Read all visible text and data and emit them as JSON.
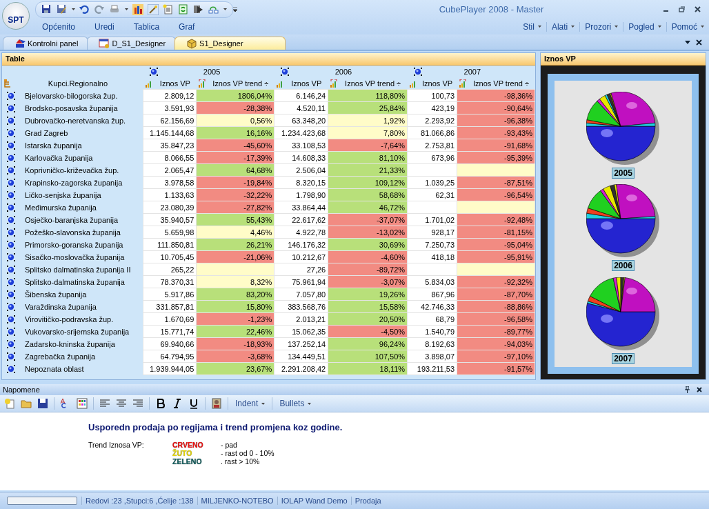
{
  "app_button": "SPT",
  "window": {
    "title": "CubePlayer 2008 - Master"
  },
  "menu": {
    "left": [
      "Općenito",
      "Uredi",
      "Tablica",
      "Graf"
    ],
    "right": [
      "Stil",
      "Alati",
      "Prozori",
      "Pogled",
      "Pomoć"
    ]
  },
  "doc_tabs": [
    {
      "label": "Kontrolni panel",
      "selected": false
    },
    {
      "label": "D_S1_Designer",
      "selected": false
    },
    {
      "label": "S1_Designer",
      "selected": true
    }
  ],
  "table_panel": {
    "title": "Table",
    "row_header": "Kupci.Regionalno",
    "columns": [
      {
        "year": "2005",
        "measures": [
          "Iznos VP",
          "Iznos VP trend ÷"
        ]
      },
      {
        "year": "2006",
        "measures": [
          "Iznos VP",
          "Iznos VP trend ÷"
        ]
      },
      {
        "year": "2007",
        "measures": [
          "Iznos VP",
          "Iznos VP trend ÷"
        ]
      }
    ],
    "rows": [
      {
        "name": "Bjelovarsko-bilogorska žup.",
        "cells": [
          {
            "value": "2.809,12",
            "trend": "1806,04%",
            "color": "#b8e07a"
          },
          {
            "value": "6.146,24",
            "trend": "118,80%",
            "color": "#b8e07a"
          },
          {
            "value": "100,73",
            "trend": "-98,36%",
            "color": "#f28b82"
          }
        ]
      },
      {
        "name": "Brodsko-posavska županija",
        "cells": [
          {
            "value": "3.591,93",
            "trend": "-28,38%",
            "color": "#f28b82"
          },
          {
            "value": "4.520,11",
            "trend": "25,84%",
            "color": "#b8e07a"
          },
          {
            "value": "423,19",
            "trend": "-90,64%",
            "color": "#f28b82"
          }
        ]
      },
      {
        "name": "Dubrovačko-neretvanska žup.",
        "cells": [
          {
            "value": "62.156,69",
            "trend": "0,56%",
            "color": "#fffcc8"
          },
          {
            "value": "63.348,20",
            "trend": "1,92%",
            "color": "#fffcc8"
          },
          {
            "value": "2.293,92",
            "trend": "-96,38%",
            "color": "#f28b82"
          }
        ]
      },
      {
        "name": "Grad Zagreb",
        "cells": [
          {
            "value": "1.145.144,68",
            "trend": "16,16%",
            "color": "#b8e07a"
          },
          {
            "value": "1.234.423,68",
            "trend": "7,80%",
            "color": "#fffcc8"
          },
          {
            "value": "81.066,86",
            "trend": "-93,43%",
            "color": "#f28b82"
          }
        ]
      },
      {
        "name": "Istarska županija",
        "cells": [
          {
            "value": "35.847,23",
            "trend": "-45,60%",
            "color": "#f28b82"
          },
          {
            "value": "33.108,53",
            "trend": "-7,64%",
            "color": "#f28b82"
          },
          {
            "value": "2.753,81",
            "trend": "-91,68%",
            "color": "#f28b82"
          }
        ]
      },
      {
        "name": "Karlovačka županija",
        "cells": [
          {
            "value": "8.066,55",
            "trend": "-17,39%",
            "color": "#f28b82"
          },
          {
            "value": "14.608,33",
            "trend": "81,10%",
            "color": "#b8e07a"
          },
          {
            "value": "673,96",
            "trend": "-95,39%",
            "color": "#f28b82"
          }
        ]
      },
      {
        "name": "Koprivničko-križevačka žup.",
        "cells": [
          {
            "value": "2.065,47",
            "trend": "64,68%",
            "color": "#b8e07a"
          },
          {
            "value": "2.506,04",
            "trend": "21,33%",
            "color": "#b8e07a"
          },
          {
            "color": "#fffcc8"
          }
        ]
      },
      {
        "name": "Krapinsko-zagorska županija",
        "cells": [
          {
            "value": "3.978,58",
            "trend": "-19,84%",
            "color": "#f28b82"
          },
          {
            "value": "8.320,15",
            "trend": "109,12%",
            "color": "#b8e07a"
          },
          {
            "value": "1.039,25",
            "trend": "-87,51%",
            "color": "#f28b82"
          }
        ]
      },
      {
        "name": "Ličko-senjska županija",
        "cells": [
          {
            "value": "1.133,63",
            "trend": "-32,22%",
            "color": "#f28b82"
          },
          {
            "value": "1.798,90",
            "trend": "58,68%",
            "color": "#b8e07a"
          },
          {
            "value": "62,31",
            "trend": "-96,54%",
            "color": "#f28b82"
          }
        ]
      },
      {
        "name": "Međimurska županija",
        "cells": [
          {
            "value": "23.080,39",
            "trend": "-27,82%",
            "color": "#f28b82"
          },
          {
            "value": "33.864,44",
            "trend": "46,72%",
            "color": "#b8e07a"
          },
          {
            "color": "#fffcc8"
          }
        ]
      },
      {
        "name": "Osječko-baranjska županija",
        "cells": [
          {
            "value": "35.940,57",
            "trend": "55,43%",
            "color": "#b8e07a"
          },
          {
            "value": "22.617,62",
            "trend": "-37,07%",
            "color": "#f28b82"
          },
          {
            "value": "1.701,02",
            "trend": "-92,48%",
            "color": "#f28b82"
          }
        ]
      },
      {
        "name": "Požeško-slavonska županija",
        "cells": [
          {
            "value": "5.659,98",
            "trend": "4,46%",
            "color": "#fffcc8"
          },
          {
            "value": "4.922,78",
            "trend": "-13,02%",
            "color": "#f28b82"
          },
          {
            "value": "928,17",
            "trend": "-81,15%",
            "color": "#f28b82"
          }
        ]
      },
      {
        "name": "Primorsko-goranska županija",
        "cells": [
          {
            "value": "111.850,81",
            "trend": "26,21%",
            "color": "#b8e07a"
          },
          {
            "value": "146.176,32",
            "trend": "30,69%",
            "color": "#b8e07a"
          },
          {
            "value": "7.250,73",
            "trend": "-95,04%",
            "color": "#f28b82"
          }
        ]
      },
      {
        "name": "Sisačko-moslovačka županija",
        "cells": [
          {
            "value": "10.705,45",
            "trend": "-21,06%",
            "color": "#f28b82"
          },
          {
            "value": "10.212,67",
            "trend": "-4,60%",
            "color": "#f28b82"
          },
          {
            "value": "418,18",
            "trend": "-95,91%",
            "color": "#f28b82"
          }
        ]
      },
      {
        "name": "Splitsko dalmatinska županija II",
        "cells": [
          {
            "value": "265,22",
            "color": "#fffcc8"
          },
          {
            "value": "27,26",
            "trend": "-89,72%",
            "color": "#f28b82"
          },
          {
            "color": "#fffcc8"
          }
        ]
      },
      {
        "name": "Splitsko-dalmatinska županija",
        "cells": [
          {
            "value": "78.370,31",
            "trend": "8,32%",
            "color": "#fffcc8"
          },
          {
            "value": "75.961,94",
            "trend": "-3,07%",
            "color": "#f28b82"
          },
          {
            "value": "5.834,03",
            "trend": "-92,32%",
            "color": "#f28b82"
          }
        ]
      },
      {
        "name": "Šibenska županija",
        "cells": [
          {
            "value": "5.917,86",
            "trend": "83,20%",
            "color": "#b8e07a"
          },
          {
            "value": "7.057,80",
            "trend": "19,26%",
            "color": "#b8e07a"
          },
          {
            "value": "867,96",
            "trend": "-87,70%",
            "color": "#f28b82"
          }
        ]
      },
      {
        "name": "Varaždinska županija",
        "cells": [
          {
            "value": "331.857,81",
            "trend": "15,80%",
            "color": "#b8e07a"
          },
          {
            "value": "383.568,76",
            "trend": "15,58%",
            "color": "#b8e07a"
          },
          {
            "value": "42.746,33",
            "trend": "-88,86%",
            "color": "#f28b82"
          }
        ]
      },
      {
        "name": "Virovitičko-podravska žup.",
        "cells": [
          {
            "value": "1.670,69",
            "trend": "-1,23%",
            "color": "#f28b82"
          },
          {
            "value": "2.013,21",
            "trend": "20,50%",
            "color": "#b8e07a"
          },
          {
            "value": "68,79",
            "trend": "-96,58%",
            "color": "#f28b82"
          }
        ]
      },
      {
        "name": "Vukovarsko-srijemska županija",
        "cells": [
          {
            "value": "15.771,74",
            "trend": "22,46%",
            "color": "#b8e07a"
          },
          {
            "value": "15.062,35",
            "trend": "-4,50%",
            "color": "#f28b82"
          },
          {
            "value": "1.540,79",
            "trend": "-89,77%",
            "color": "#f28b82"
          }
        ]
      },
      {
        "name": "Zadarsko-kninska županija",
        "cells": [
          {
            "value": "69.940,66",
            "trend": "-18,93%",
            "color": "#f28b82"
          },
          {
            "value": "137.252,14",
            "trend": "96,24%",
            "color": "#b8e07a"
          },
          {
            "value": "8.192,63",
            "trend": "-94,03%",
            "color": "#f28b82"
          }
        ]
      },
      {
        "name": "Zagrebačka županija",
        "cells": [
          {
            "value": "64.794,95",
            "trend": "-3,68%",
            "color": "#f28b82"
          },
          {
            "value": "134.449,51",
            "trend": "107,50%",
            "color": "#b8e07a"
          },
          {
            "value": "3.898,07",
            "trend": "-97,10%",
            "color": "#f28b82"
          }
        ]
      },
      {
        "name": "Nepoznata oblast",
        "cells": [
          {
            "value": "1.939.944,05",
            "trend": "23,67%",
            "color": "#b8e07a"
          },
          {
            "value": "2.291.208,42",
            "trend": "18,11%",
            "color": "#b8e07a"
          },
          {
            "value": "193.211,53",
            "trend": "-91,57%",
            "color": "#f28b82"
          }
        ]
      }
    ]
  },
  "chart_panel": {
    "title": "Iznos VP",
    "pies": [
      {
        "label": "2005"
      },
      {
        "label": "2006"
      },
      {
        "label": "2007"
      }
    ]
  },
  "notes": {
    "title": "Napomene",
    "toolbar_menus": [
      "Indent",
      "Bullets"
    ],
    "heading": "Usporedn prodaja po regijama i trend promjena koz godine.",
    "legend_label": "Trend Iznosa VP:",
    "legend": [
      {
        "name": "CRVENO",
        "color": "#ee1111",
        "text": "- pad"
      },
      {
        "name": "ŽUTO",
        "color": "#e6d800",
        "text": "- rast od 0 - 10%"
      },
      {
        "name": "ZELENO",
        "color": "#115f5f",
        "text": ". rast > 10%"
      }
    ]
  },
  "status_bar": {
    "progress": {
      "level": 0
    },
    "fields": [
      "Redovi :23 ,Stupci:6 ,Ćelije :138",
      "MILJENKO-NOTEBO",
      "IOLAP Wand Demo",
      "Prodaja"
    ]
  }
}
